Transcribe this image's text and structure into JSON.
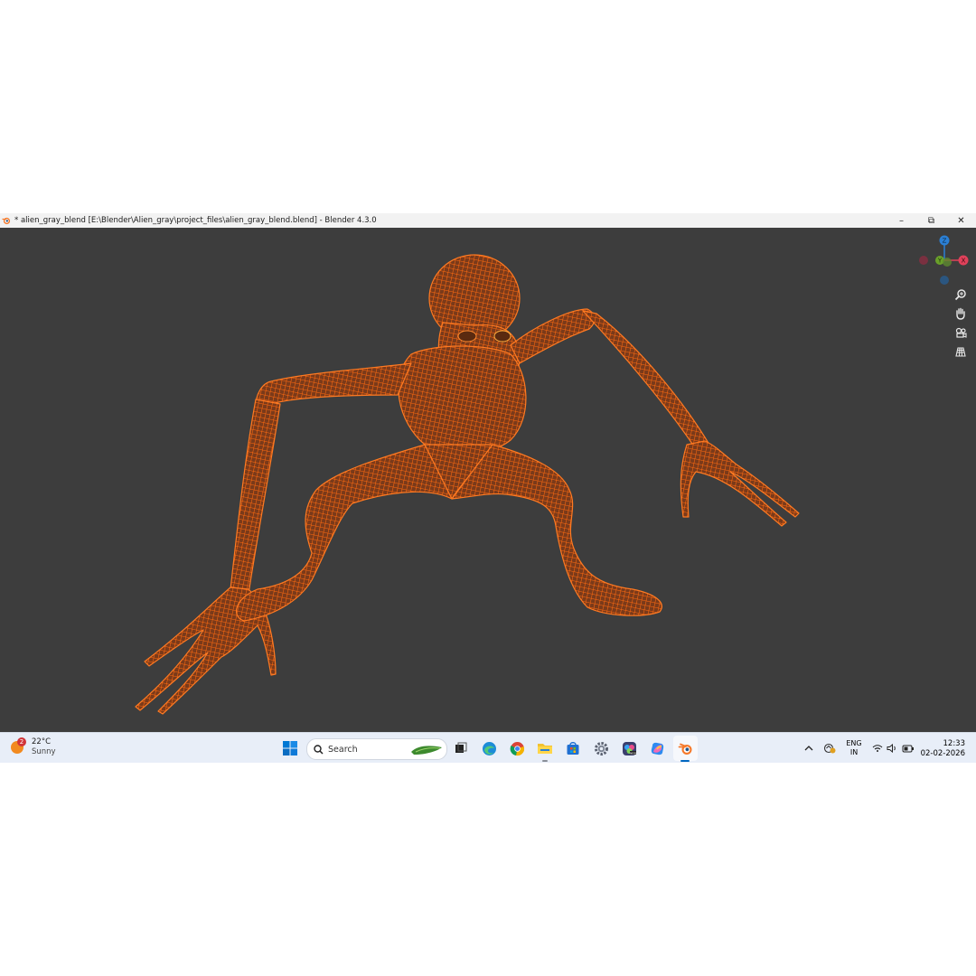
{
  "window": {
    "title": "* alien_gray_blend [E:\\Blender\\Alien_gray\\project_files\\alien_gray_blend.blend] - Blender 4.3.0",
    "minimize_glyph": "–",
    "restore_glyph": "⧉",
    "close_glyph": "✕"
  },
  "viewport": {
    "background": "#3d3d3d",
    "wire_color": "#ff6a10",
    "gizmo": {
      "z_label": "Z",
      "y_label": "Y",
      "x_label": "X",
      "z_color": "#2b7fd4",
      "y_color": "#6aa02a",
      "x_color": "#e0415a"
    },
    "nav_tools": [
      "zoom-icon",
      "pan-hand-icon",
      "camera-icon",
      "grid-icon"
    ]
  },
  "taskbar": {
    "weather": {
      "temp": "22°C",
      "condition": "Sunny",
      "badge": "2"
    },
    "search_placeholder": "Search",
    "pinned_apps": [
      "task-view-icon",
      "edge-icon",
      "chrome-icon",
      "file-explorer-icon",
      "store-icon",
      "settings-icon",
      "photos-icon",
      "copilot-icon",
      "blender-icon"
    ],
    "tray": {
      "lang_top": "ENG",
      "lang_bottom": "IN",
      "time": "12:33",
      "date": "02-02-2026"
    }
  }
}
